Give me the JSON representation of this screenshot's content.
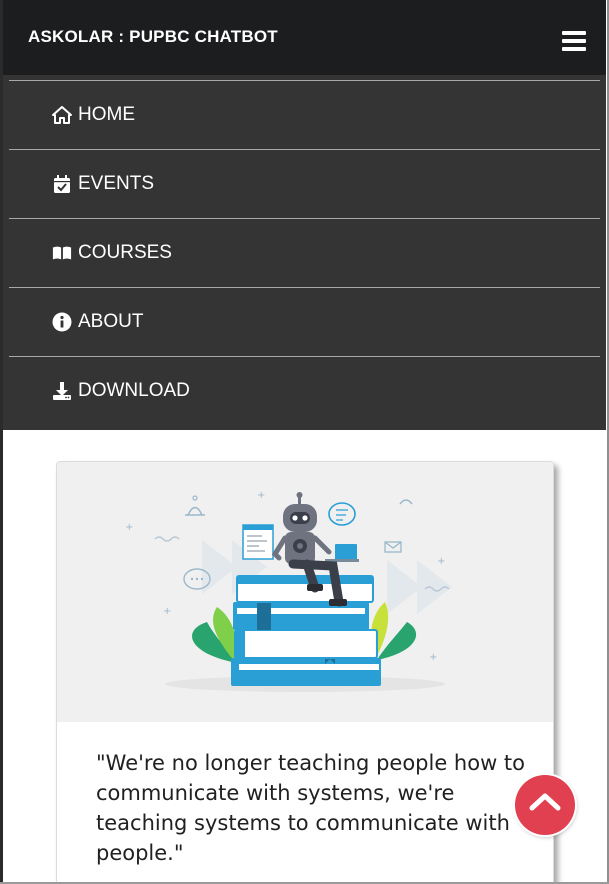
{
  "navbar": {
    "brand": "ASKOLAR : PUPBC CHATBOT",
    "menu_toggle_icon": "hamburger-icon"
  },
  "menu": {
    "items": [
      {
        "label": "HOME",
        "icon": "home-icon"
      },
      {
        "label": "EVENTS",
        "icon": "calendar-check-icon"
      },
      {
        "label": "COURSES",
        "icon": "book-open-icon"
      },
      {
        "label": "ABOUT",
        "icon": "info-circle-icon"
      },
      {
        "label": "DOWNLOAD",
        "icon": "download-icon"
      }
    ]
  },
  "card": {
    "image_icon": "robot-on-books-illustration",
    "quote": "\"We're no longer teaching people how to communicate with systems, we're teaching systems to communicate with people.\""
  },
  "scroll_top": {
    "icon": "chevron-up-icon"
  },
  "colors": {
    "navbar_bg": "#1c1d1e",
    "menu_bg": "#343434",
    "accent": "#e0404f",
    "illustration_blue": "#2a9fd6"
  }
}
